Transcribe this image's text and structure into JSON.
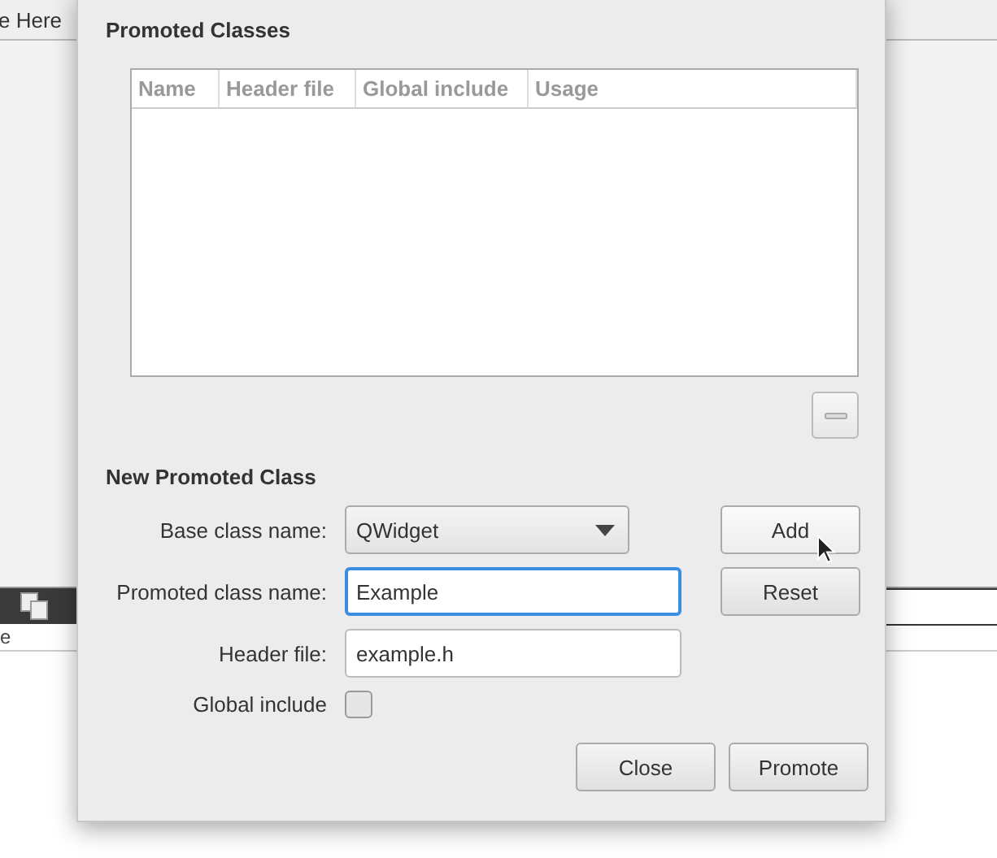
{
  "background": {
    "tab_text": "e Here",
    "panel_text": "e"
  },
  "dialog": {
    "promoted_title": "Promoted Classes",
    "table": {
      "columns": [
        "Name",
        "Header file",
        "Global include",
        "Usage"
      ]
    },
    "remove_button": {
      "disabled": true
    },
    "new_title": "New Promoted Class",
    "fields": [
      {
        "kind": "combo",
        "label": "Base class name:",
        "value": "QWidget",
        "focused": false
      },
      {
        "kind": "text",
        "label": "Promoted class name:",
        "value": "Example",
        "focused": true
      },
      {
        "kind": "text",
        "label": "Header file:",
        "value": "example.h",
        "focused": false
      },
      {
        "kind": "checkbox",
        "label": "Global include",
        "checked": false
      }
    ],
    "side_buttons": [
      {
        "label": "Add",
        "hovered": true
      },
      {
        "label": "Reset",
        "hovered": false
      }
    ],
    "buttons": [
      "Close",
      "Promote"
    ]
  }
}
